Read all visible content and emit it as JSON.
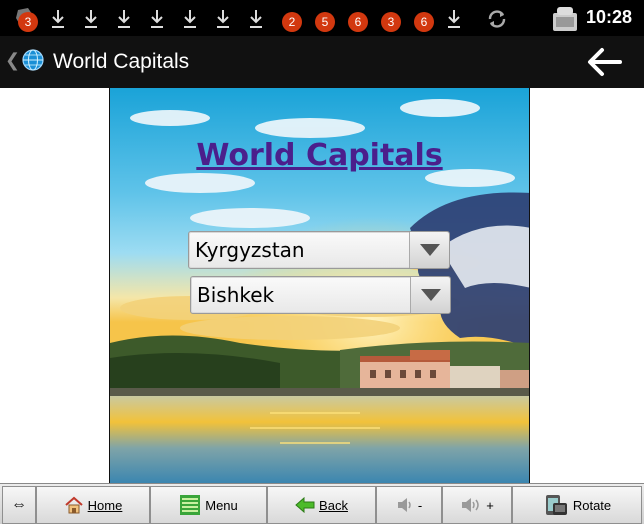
{
  "statusbar": {
    "badges": [
      "3",
      "2",
      "5",
      "6",
      "3",
      "6"
    ],
    "time": "10:28"
  },
  "actionbar": {
    "title": "World Capitals",
    "caret": "❮"
  },
  "page": {
    "heading": "World Capitals",
    "country_select": {
      "value": "Kyrgyzstan"
    },
    "capital_select": {
      "value": "Bishkek"
    }
  },
  "toolbar": {
    "resize_glyph": "⇔",
    "home_label": "Home",
    "menu_label": "Menu",
    "back_label": "Back",
    "vol_down_label": "-",
    "vol_up_label": "+",
    "rotate_label": "Rotate"
  },
  "colors": {
    "badge": "#d2380f",
    "heading": "#4b1f8c",
    "statusbar": "#000000",
    "actionbar": "#111111"
  }
}
